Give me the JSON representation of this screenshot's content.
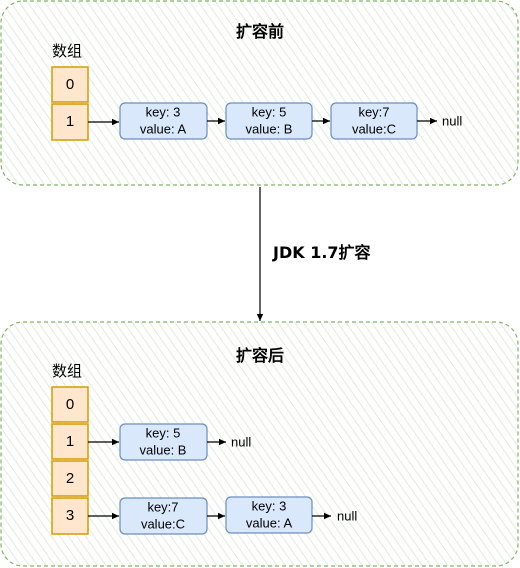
{
  "transition_label": "JDK 1.7扩容",
  "before": {
    "title": "扩容前",
    "array_label": "数组",
    "cells": [
      "0",
      "1"
    ],
    "chain": [
      {
        "key": "key: 3",
        "value": "value: A"
      },
      {
        "key": "key: 5",
        "value": "value: B"
      },
      {
        "key": "key:7",
        "value": "value:C"
      }
    ],
    "null_label": "null"
  },
  "after": {
    "title": "扩容后",
    "array_label": "数组",
    "cells": [
      "0",
      "1",
      "2",
      "3"
    ],
    "chain_1": [
      {
        "key": "key: 5",
        "value": "value: B"
      }
    ],
    "chain_1_null": "null",
    "chain_3": [
      {
        "key": "key:7",
        "value": "value:C"
      },
      {
        "key": "key: 3",
        "value": "value: A"
      }
    ],
    "chain_3_null": "null"
  },
  "colors": {
    "panel_stroke": "#82b366",
    "cell_fill": "#ffe6cc",
    "cell_stroke": "#d79b00",
    "node_fill": "#dae8fc",
    "node_stroke": "#6c8ebf"
  }
}
